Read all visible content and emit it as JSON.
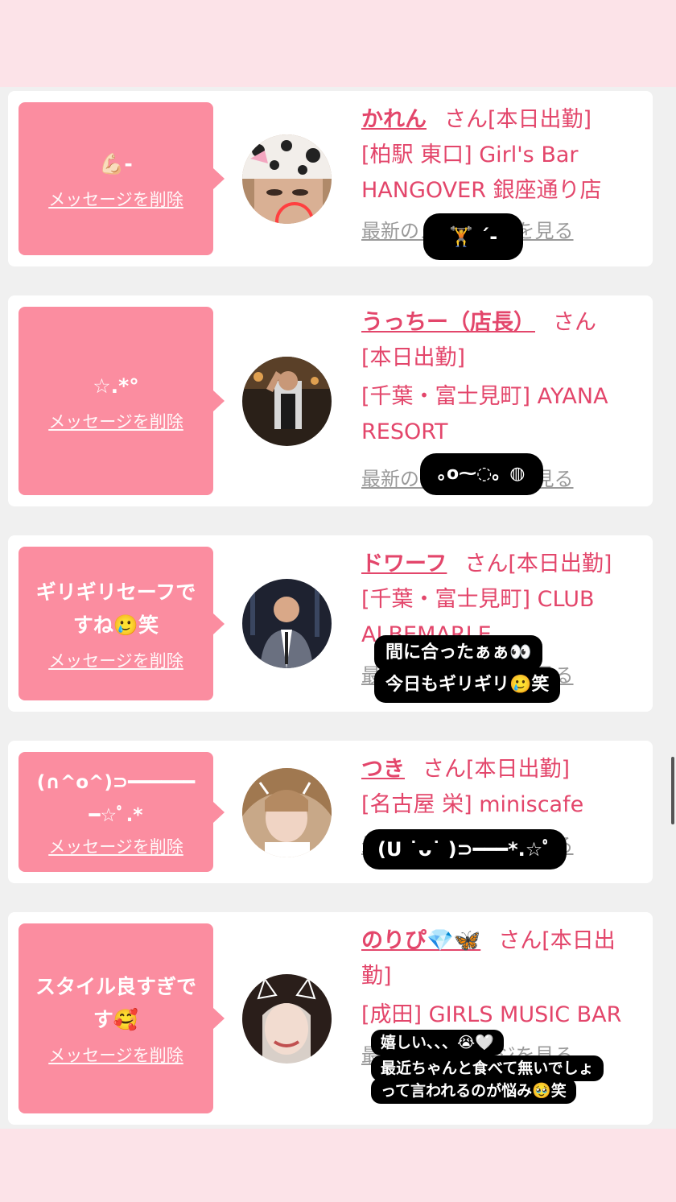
{
  "cards": [
    {
      "message": "💪🏻-",
      "delete_label": "メッセージを削除",
      "name": "かれん",
      "san": "さん",
      "status": "[本日出勤]",
      "shop": "[柏駅 東口] Girl's Bar HANGOVER 銀座通り店",
      "latest": "最新のメッセージを見る",
      "overlay": "🏋️ ˊ-"
    },
    {
      "message": "☆.*°",
      "delete_label": "メッセージを削除",
      "name": "うっちー（店長）",
      "san": "さん",
      "status": "[本日出勤]",
      "shop": "[千葉・富士見町] AYANA RESORT",
      "latest": "最新のメッセージを見る",
      "overlay": "｡o⁓◌。◍"
    },
    {
      "message": "ギリギリセーフで\nすね🥲笑",
      "delete_label": "メッセージを削除",
      "name": "ドワーフ",
      "san": "さん",
      "status": "[本日出勤]",
      "shop": "[千葉・富士見町] CLUB ALBEMARLE",
      "latest": "最新のメッセージを見る",
      "overlay1": "間に合ったぁぁ👀",
      "overlay2": "今日もギリギリ🥲笑"
    },
    {
      "message": "(∩^o^)⊃━━━━━━\n━☆ﾟ.*",
      "delete_label": "メッセージを削除",
      "name": "つき",
      "san": "さん",
      "status": "[本日出勤]",
      "shop": "[名古屋 栄] miniscafe",
      "latest": "最新のメッセージを見る",
      "overlay": "(ᑌ ˙ᴗ˙ )⊃━━━*.☆ﾟ"
    },
    {
      "message": "スタイル良すぎで\nす🥰",
      "delete_label": "メッセージを削除",
      "name": "のりぴ💎🦋",
      "san": "さん",
      "status": "[本日出勤]",
      "shop": "[成田] GIRLS MUSIC BAR",
      "latest": "最新のメッセージを見る",
      "overlay1": "嬉しい、、、😭🤍",
      "overlay2": "最近ちゃんと食べて無いでしょ",
      "overlay3": "って言われるのが悩み🥹笑"
    }
  ],
  "colors": {
    "accent": "#e3466b",
    "bubble": "#fb8da0",
    "header_bg": "#fce3e8",
    "page_bg": "#f0f0f0"
  }
}
